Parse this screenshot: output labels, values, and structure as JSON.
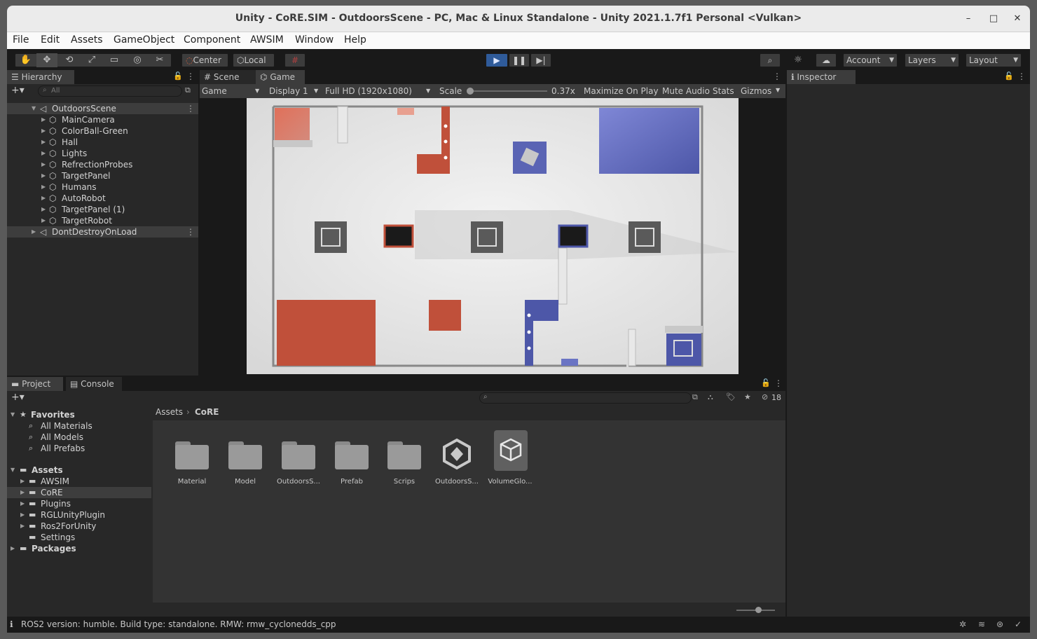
{
  "window": {
    "title": "Unity - CoRE.SIM - OutdoorsScene - PC, Mac & Linux Standalone - Unity 2021.1.7f1 Personal <Vulkan>",
    "minimize": "–",
    "maximize": "□",
    "close": "✕"
  },
  "menu": [
    "File",
    "Edit",
    "Assets",
    "GameObject",
    "Component",
    "AWSIM",
    "Window",
    "Help"
  ],
  "toolbar": {
    "center_label": "Center",
    "local_label": "Local",
    "account_label": "Account",
    "layers_label": "Layers",
    "layout_label": "Layout",
    "accent": "#2f5b9a"
  },
  "hierarchy": {
    "tab": "Hierarchy",
    "search_placeholder": "All",
    "scene": "OutdoorsScene",
    "items": [
      "MainCamera",
      "ColorBall-Green",
      "Hall",
      "Lights",
      "RefrectionProbes",
      "TargetPanel",
      "Humans",
      "AutoRobot",
      "TargetPanel (1)",
      "TargetRobot"
    ],
    "dont_destroy": "DontDestroyOnLoad"
  },
  "game": {
    "tabs": [
      "Scene",
      "Game"
    ],
    "mode": "Game",
    "display": "Display 1",
    "resolution": "Full HD (1920x1080)",
    "scale_label": "Scale",
    "scale_value": "0.37x",
    "maximize": "Maximize On Play",
    "mute": "Mute Audio",
    "stats": "Stats",
    "gizmos": "Gizmos",
    "colors": {
      "red": "#c0503a",
      "blue": "#4d57a8",
      "floor": "#e6e6e6"
    }
  },
  "inspector": {
    "tab": "Inspector"
  },
  "project": {
    "tabs": [
      "Project",
      "Console"
    ],
    "hidden_count": "18",
    "favorites_label": "Favorites",
    "favorites": [
      "All Materials",
      "All Models",
      "All Prefabs"
    ],
    "assets_label": "Assets",
    "asset_folders": [
      "AWSIM",
      "CoRE",
      "Plugins",
      "RGLUnityPlugin",
      "Ros2ForUnity",
      "Settings"
    ],
    "packages_label": "Packages",
    "breadcrumb": [
      "Assets",
      "CoRE"
    ],
    "items": [
      {
        "name": "Material",
        "icon": "folder-icon"
      },
      {
        "name": "Model",
        "icon": "folder-icon"
      },
      {
        "name": "OutdoorsS...",
        "icon": "folder-icon"
      },
      {
        "name": "Prefab",
        "icon": "folder-icon"
      },
      {
        "name": "Scrips",
        "icon": "folder-icon"
      },
      {
        "name": "OutdoorsS...",
        "icon": "unity-scene-icon"
      },
      {
        "name": "VolumeGlo...",
        "icon": "volume-profile-icon"
      }
    ]
  },
  "status": {
    "text": "ROS2 version: humble. Build type: standalone. RMW: rmw_cyclonedds_cpp"
  }
}
